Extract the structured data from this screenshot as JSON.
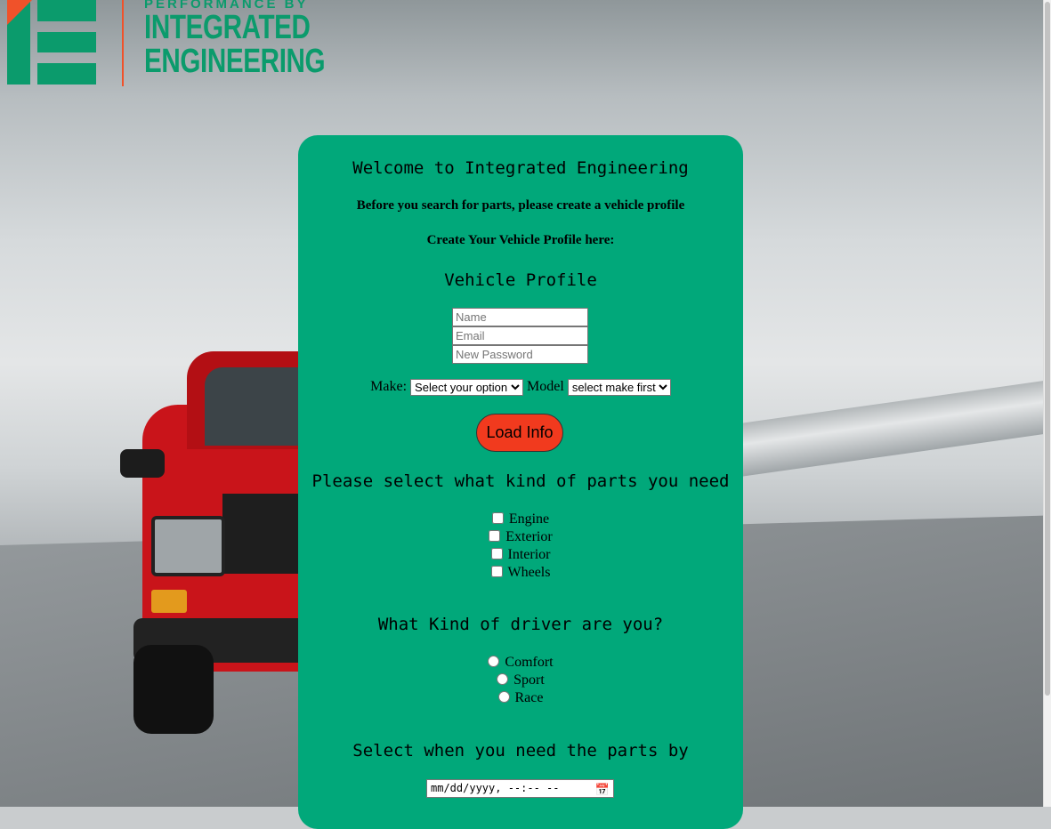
{
  "brand": {
    "performance_by": "PERFORMANCE BY",
    "line1": "INTEGRATED",
    "line2": "ENGINEERING",
    "colors": {
      "green": "#0b9b6c",
      "orange": "#f0522a"
    }
  },
  "panel": {
    "title": "Welcome to Integrated Engineering",
    "subtitle1": "Before you search for parts, please create a vehicle profile",
    "subtitle2": "Create Your Vehicle Profile here:",
    "profile_heading": "Vehicle Profile",
    "name_placeholder": "Name",
    "email_placeholder": "Email",
    "password_placeholder": "New Password",
    "make_label": "Make:",
    "make_selected": "Select your option",
    "model_label": "Model",
    "model_selected": "select make first",
    "load_button": "Load Info",
    "parts_heading": "Please select what kind of parts you need",
    "parts": [
      "Engine",
      "Exterior",
      "Interior",
      "Wheels"
    ],
    "driver_heading": "What Kind of driver are you?",
    "driver_types": [
      "Comfort",
      "Sport",
      "Race"
    ],
    "date_heading": "Select when you need the parts by",
    "date_placeholder": "mm/dd/yyyy, --:-- --",
    "calendar_icon": "calendar-icon",
    "colors": {
      "panel": "#01a87a",
      "button": "#f13a1e"
    }
  }
}
